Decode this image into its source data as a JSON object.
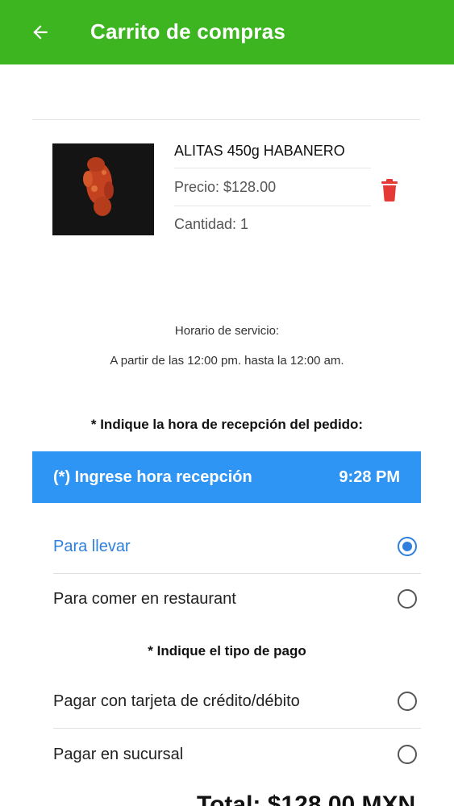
{
  "header": {
    "title": "Carrito de compras",
    "back_icon": "arrow-left-icon",
    "background_color": "#3cb520"
  },
  "cart": {
    "items": [
      {
        "name": "ALITAS 450g HABANERO",
        "price_label": "Precio: $128.00",
        "quantity_label": "Cantidad: 1",
        "delete_icon": "trash-icon",
        "delete_color": "#e53935"
      }
    ]
  },
  "service_hours": {
    "title": "Horario de servicio:",
    "hours": "A partir de las 12:00 pm. hasta la 12:00 am."
  },
  "pickup": {
    "heading": "* Indique la hora de recepción del pedido:",
    "time_button_label": "(*) Ingrese hora recepción",
    "time_value": "9:28 PM",
    "button_color": "#2f95f5"
  },
  "order_type": {
    "options": [
      {
        "label": "Para llevar",
        "selected": true
      },
      {
        "label": "Para comer en restaurant",
        "selected": false
      }
    ]
  },
  "payment": {
    "heading": "* Indique el tipo de pago",
    "options": [
      {
        "label": "Pagar con tarjeta de crédito/débito",
        "selected": false
      },
      {
        "label": "Pagar en sucursal",
        "selected": false
      }
    ]
  },
  "total": {
    "label": "Total: $128.00 MXN"
  }
}
